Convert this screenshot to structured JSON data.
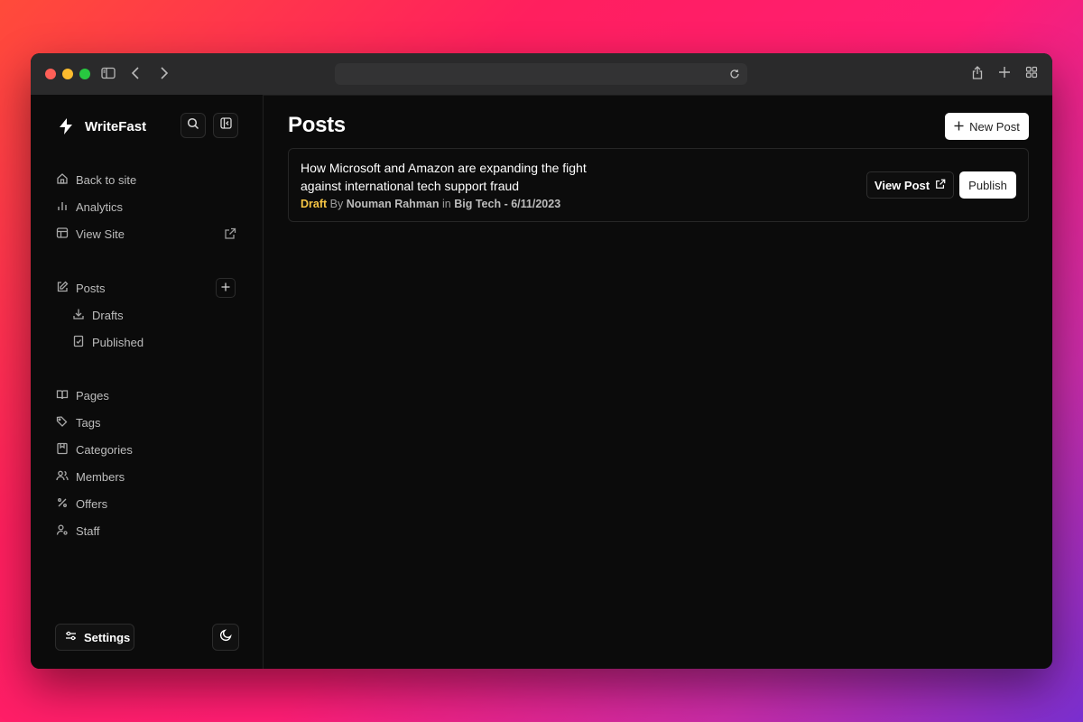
{
  "colors": {
    "accent_draft": "#f6c544",
    "traffic_close": "#ff5f57",
    "traffic_minimize": "#febc2e",
    "traffic_zoom": "#28c840"
  },
  "browser": {
    "icons": [
      "sidebar-icon",
      "back-icon",
      "forward-icon",
      "reload-icon",
      "share-icon",
      "new-tab-icon",
      "tab-overview-icon"
    ]
  },
  "brand": {
    "name": "WriteFast"
  },
  "sidebar": {
    "nav_top": [
      {
        "label": "Back to site",
        "icon": "home-icon"
      },
      {
        "label": "Analytics",
        "icon": "bar-chart-icon"
      },
      {
        "label": "View Site",
        "icon": "layout-icon"
      }
    ],
    "posts": {
      "label": "Posts",
      "sub": [
        {
          "label": "Drafts",
          "icon": "download-icon"
        },
        {
          "label": "Published",
          "icon": "file-check-icon"
        }
      ]
    },
    "nav_bottom": [
      {
        "label": "Pages",
        "icon": "book-icon"
      },
      {
        "label": "Tags",
        "icon": "tags-icon"
      },
      {
        "label": "Categories",
        "icon": "bookmark-icon"
      },
      {
        "label": "Members",
        "icon": "users-icon"
      },
      {
        "label": "Offers",
        "icon": "percent-icon"
      },
      {
        "label": "Staff",
        "icon": "user-cog-icon"
      }
    ],
    "settings_label": "Settings"
  },
  "main": {
    "title": "Posts",
    "new_post_label": "New Post",
    "posts": [
      {
        "title": "How Microsoft and Amazon are expanding the fight against international tech support fraud",
        "status": "Draft",
        "by": "By",
        "author": "Nouman Rahman",
        "in": "in",
        "category": "Big Tech",
        "sep": "-",
        "date": "6/11/2023",
        "view_label": "View Post",
        "publish_label": "Publish"
      }
    ]
  }
}
